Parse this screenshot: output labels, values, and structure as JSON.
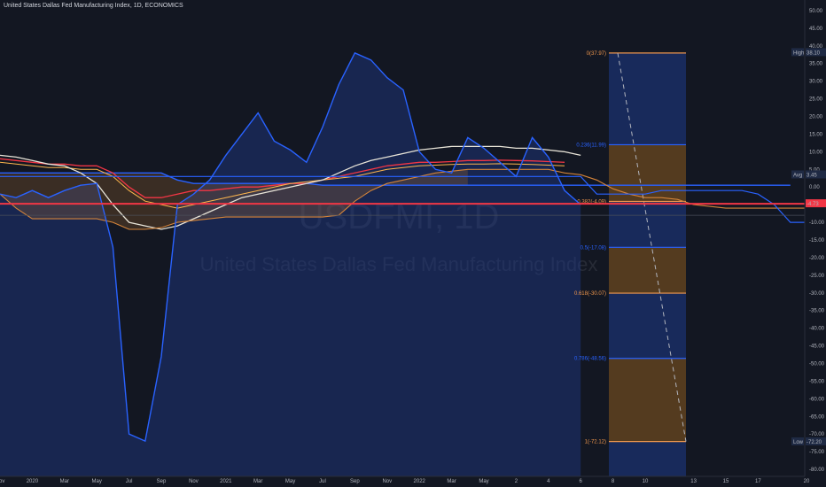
{
  "header": {
    "symbol_name": "United States Dallas Fed Manufacturing Index",
    "interval": "1D",
    "source": "ECONOMICS"
  },
  "watermark": {
    "ticker": "USDFMI, 1D",
    "name": "United States Dallas Fed Manufacturing Index"
  },
  "price_tags": {
    "high_label": "High",
    "high_value": "38.10",
    "avg_label": "Avg",
    "avg_value": "3.45",
    "current_value": "-4.73",
    "low_label": "Low",
    "low_value": "-72.20"
  },
  "fib_levels": [
    {
      "ratio": "0",
      "value": "37.97",
      "label": "0(37.97)",
      "color": "#f0974c"
    },
    {
      "ratio": "0.236",
      "value": "11.99",
      "label": "0.236(11.99)",
      "color": "#2962ff"
    },
    {
      "ratio": "0.382",
      "value": "-4.09",
      "label": "0.382(-4.09)",
      "color": "#f0974c"
    },
    {
      "ratio": "0.5",
      "value": "-17.08",
      "label": "0.5(-17.08)",
      "color": "#2962ff"
    },
    {
      "ratio": "0.618",
      "value": "-30.07",
      "label": "0.618(-30.07)",
      "color": "#f0974c"
    },
    {
      "ratio": "0.786",
      "value": "-48.56",
      "label": "0.786(-48.56)",
      "color": "#2962ff"
    },
    {
      "ratio": "1",
      "value": "-72.12",
      "label": "1(-72.12)",
      "color": "#f0974c"
    }
  ],
  "colors": {
    "background": "#131722",
    "index_line": "#2962ff",
    "current_line": "#f23645",
    "fib_orange": "#f0974c",
    "fib_blue": "#2962ff"
  },
  "chart_data": {
    "type": "line",
    "title": "United States Dallas Fed Manufacturing Index",
    "ylim": [
      -82,
      52
    ],
    "y_ticks": [
      50,
      45,
      40,
      35,
      30,
      25,
      20,
      15,
      10,
      5,
      0,
      -5,
      -10,
      -15,
      -20,
      -25,
      -30,
      -35,
      -40,
      -45,
      -50,
      -55,
      -60,
      -65,
      -70,
      -75,
      -80
    ],
    "x_ticks": [
      "Nov",
      "2020",
      "Mar",
      "May",
      "Jul",
      "Sep",
      "Nov",
      "2021",
      "Mar",
      "May",
      "Jul",
      "Sep",
      "Nov",
      "2022",
      "Mar",
      "May",
      "2",
      "4",
      "6",
      "8",
      "10",
      "13",
      "15",
      "17",
      "20"
    ],
    "x_tick_index": [
      0,
      2,
      4,
      6,
      8,
      10,
      12,
      14,
      16,
      18,
      20,
      22,
      24,
      26,
      28,
      30,
      32,
      34,
      36,
      38,
      40,
      43,
      45,
      47,
      50
    ],
    "series": [
      {
        "values": [
          -2,
          -3,
          -1,
          -3,
          -1,
          0.5,
          1,
          -17,
          -70,
          -72,
          -48,
          -5,
          -2,
          2,
          9,
          15,
          21,
          13,
          10.5,
          7,
          17,
          29,
          38,
          36,
          31,
          27.5,
          10,
          5,
          4,
          14,
          11,
          7,
          3,
          14,
          8.5,
          -1,
          -5
        ]
      },
      {
        "values": [
          4,
          4,
          4,
          4,
          4,
          4,
          4,
          4,
          4,
          4,
          4,
          2,
          1,
          1,
          1,
          1,
          1,
          1,
          1,
          1,
          0.5,
          0.5,
          0.5,
          0.5,
          0.5,
          0.5,
          0.5,
          0.5,
          0.5,
          0.5,
          0.5,
          0.5,
          0.5,
          0.5,
          0.5,
          0.5,
          0.5,
          0.5,
          0.5,
          0.5,
          0.5,
          0.5,
          0.5,
          0.5,
          0.5,
          0.5,
          0.5,
          0.5,
          0.5,
          0.5
        ]
      },
      {
        "values": [
          8,
          7.5,
          7,
          6.5,
          6.5,
          6,
          6,
          4,
          0,
          -3,
          -3,
          -2,
          -1,
          -1,
          -0.5,
          0,
          0,
          0.5,
          1,
          1,
          2,
          3,
          4,
          5,
          6,
          6.5,
          7,
          7,
          7.2,
          7.5,
          7.5,
          7.6,
          7.5,
          7.4,
          7.2,
          7
        ]
      },
      {
        "values": [
          7,
          6.5,
          6,
          5.5,
          5.5,
          5,
          5,
          3,
          -1,
          -4,
          -5,
          -6,
          -5,
          -4,
          -3,
          -2,
          -1,
          0,
          1,
          1.5,
          2,
          2.5,
          3,
          4,
          5,
          5.5,
          6,
          6.2,
          6.4,
          6.5,
          6.5,
          6.6,
          6.5,
          6.4,
          6.2,
          6
        ]
      },
      {
        "values": [
          9,
          8.5,
          7.5,
          6.5,
          6,
          4,
          1,
          -5,
          -10,
          -11,
          -12,
          -11,
          -9,
          -7,
          -5,
          -3,
          -2,
          -1,
          0,
          1,
          2,
          4,
          6,
          7.5,
          8.5,
          9.5,
          10.5,
          11,
          11.5,
          11.5,
          11.5,
          11.5,
          11,
          11,
          10.5,
          10,
          9
        ]
      },
      {
        "values": [
          -2,
          -6,
          -9,
          -9,
          -9,
          -9,
          -9,
          -10,
          -12,
          -12,
          -11.5,
          -10,
          -9.5,
          -9,
          -8.5,
          -8.5,
          -8.5,
          -8.5,
          -8.5,
          -8.5,
          -8.5,
          -8,
          -4,
          -1,
          1,
          2,
          3,
          4,
          4.5,
          5,
          5,
          5,
          5,
          5,
          5,
          4,
          3.5,
          2,
          -0.5,
          -2,
          -3,
          -3,
          -3.5,
          -5,
          -5.5,
          -6,
          -6,
          -6,
          -6,
          -6,
          -6,
          -7,
          -11,
          -15,
          -15,
          -15,
          -15,
          -15,
          -15,
          -15,
          -14.5,
          -14,
          -13.5,
          -13,
          -12.5,
          -12,
          -11.5,
          -11,
          -10.5
        ]
      },
      {
        "values": [
          3,
          3,
          3,
          3,
          3,
          3,
          3,
          3,
          3,
          3,
          3,
          3,
          3,
          3,
          3,
          3,
          3,
          3,
          3,
          3,
          3,
          3,
          3,
          3,
          3,
          3,
          3,
          3,
          3,
          3,
          3,
          3,
          3,
          3,
          3,
          3,
          3,
          -2,
          -2,
          -2,
          -2,
          -1,
          -1,
          -1,
          -1,
          -1,
          -1,
          -2,
          -5,
          -10,
          -10,
          -10,
          -10,
          -10,
          -10,
          -10,
          -10,
          -10,
          -10,
          -10,
          -10,
          -10,
          -10,
          -10,
          -10,
          -10,
          -10,
          -10
        ]
      }
    ]
  }
}
